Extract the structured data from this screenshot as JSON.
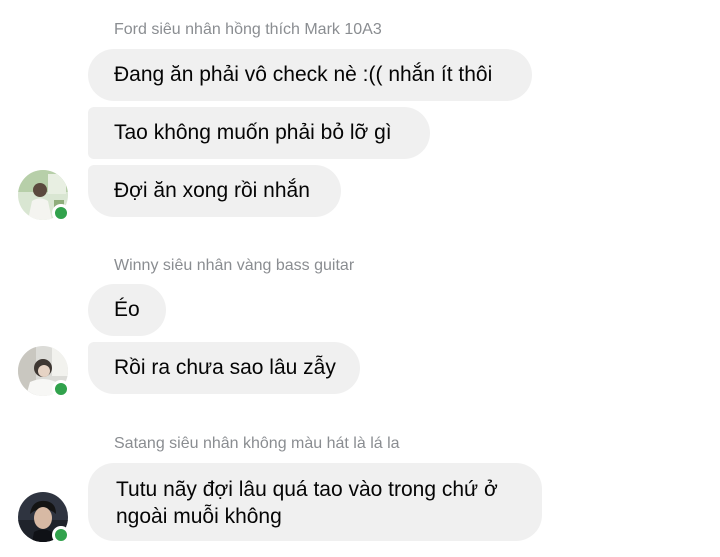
{
  "groups": [
    {
      "sender": "Ford siêu nhân hồng thích Mark 10A3",
      "messages": [
        "Đang ăn phải vô check nè :(( nhắn ít thôi",
        "Tao không muốn phải bỏ lỡ gì",
        "Đợi ăn xong rồi nhắn"
      ],
      "online": true
    },
    {
      "sender": "Winny siêu nhân vàng bass guitar",
      "messages": [
        "Éo",
        "Rồi ra chưa sao lâu zẫy"
      ],
      "online": true
    },
    {
      "sender": "Satang siêu nhân không màu hát là lá la",
      "messages": [
        "Tutu nãy đợi lâu quá tao vào trong chứ ở ngoài muỗi không"
      ],
      "online": true
    }
  ],
  "colors": {
    "bubble": "#f0f0f0",
    "sender_text": "#8a8d91",
    "message_text": "#050505",
    "online_dot": "#31a24c"
  }
}
